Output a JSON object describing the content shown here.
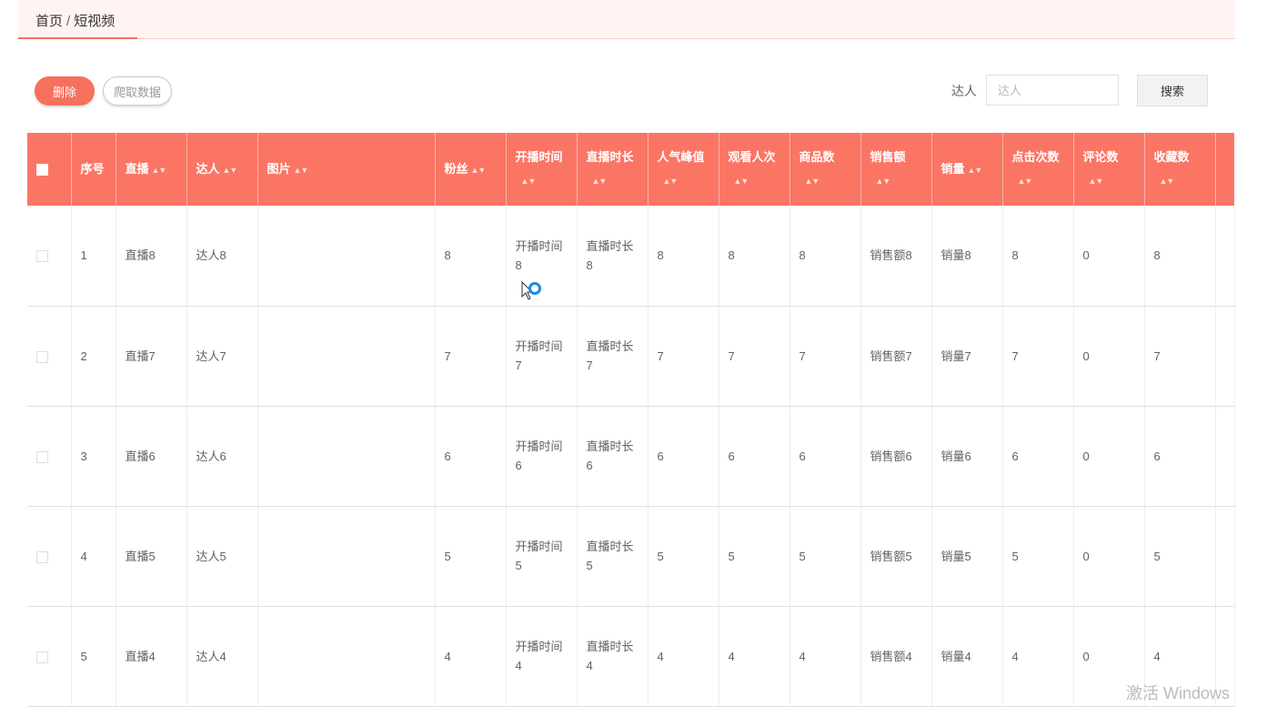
{
  "breadcrumb": {
    "home": "首页",
    "separator": "/",
    "current": "短视频"
  },
  "toolbar": {
    "delete_label": "删除",
    "crawl_label": "爬取数据"
  },
  "search": {
    "label": "达人",
    "placeholder": "达人",
    "button_label": "搜索"
  },
  "table": {
    "headers": {
      "index": "序号",
      "live": "直播",
      "expert": "达人",
      "image": "图片",
      "fans": "粉丝",
      "start_time": "开播时间",
      "duration": "直播时长",
      "peak": "人气峰值",
      "viewers": "观看人次",
      "goods": "商品数",
      "sales_amount": "销售额",
      "sales_volume": "销量",
      "clicks": "点击次数",
      "comments": "评论数",
      "favorites": "收藏数"
    },
    "rows": [
      {
        "index": "1",
        "live": "直播8",
        "expert": "达人8",
        "image": "",
        "fans": "8",
        "start_time": "开播时间8",
        "duration": "直播时长8",
        "peak": "8",
        "viewers": "8",
        "goods": "8",
        "sales_amount": "销售额8",
        "sales_volume": "销量8",
        "clicks": "8",
        "comments": "0",
        "favorites": "8"
      },
      {
        "index": "2",
        "live": "直播7",
        "expert": "达人7",
        "image": "",
        "fans": "7",
        "start_time": "开播时间7",
        "duration": "直播时长7",
        "peak": "7",
        "viewers": "7",
        "goods": "7",
        "sales_amount": "销售额7",
        "sales_volume": "销量7",
        "clicks": "7",
        "comments": "0",
        "favorites": "7"
      },
      {
        "index": "3",
        "live": "直播6",
        "expert": "达人6",
        "image": "",
        "fans": "6",
        "start_time": "开播时间6",
        "duration": "直播时长6",
        "peak": "6",
        "viewers": "6",
        "goods": "6",
        "sales_amount": "销售额6",
        "sales_volume": "销量6",
        "clicks": "6",
        "comments": "0",
        "favorites": "6"
      },
      {
        "index": "4",
        "live": "直播5",
        "expert": "达人5",
        "image": "",
        "fans": "5",
        "start_time": "开播时间5",
        "duration": "直播时长5",
        "peak": "5",
        "viewers": "5",
        "goods": "5",
        "sales_amount": "销售额5",
        "sales_volume": "销量5",
        "clicks": "5",
        "comments": "0",
        "favorites": "5"
      },
      {
        "index": "5",
        "live": "直播4",
        "expert": "达人4",
        "image": "",
        "fans": "4",
        "start_time": "开播时间4",
        "duration": "直播时长4",
        "peak": "4",
        "viewers": "4",
        "goods": "4",
        "sales_amount": "销售额4",
        "sales_volume": "销量4",
        "clicks": "4",
        "comments": "0",
        "favorites": "4"
      }
    ]
  },
  "watermark": "激活 Windows",
  "colors": {
    "accent": "#f5715d",
    "header_bg": "#fb7565",
    "breadcrumb_bg": "#fff4f1"
  },
  "icons": {
    "sort": "sort-caret-icon",
    "cursor": "busy-cursor-icon"
  }
}
